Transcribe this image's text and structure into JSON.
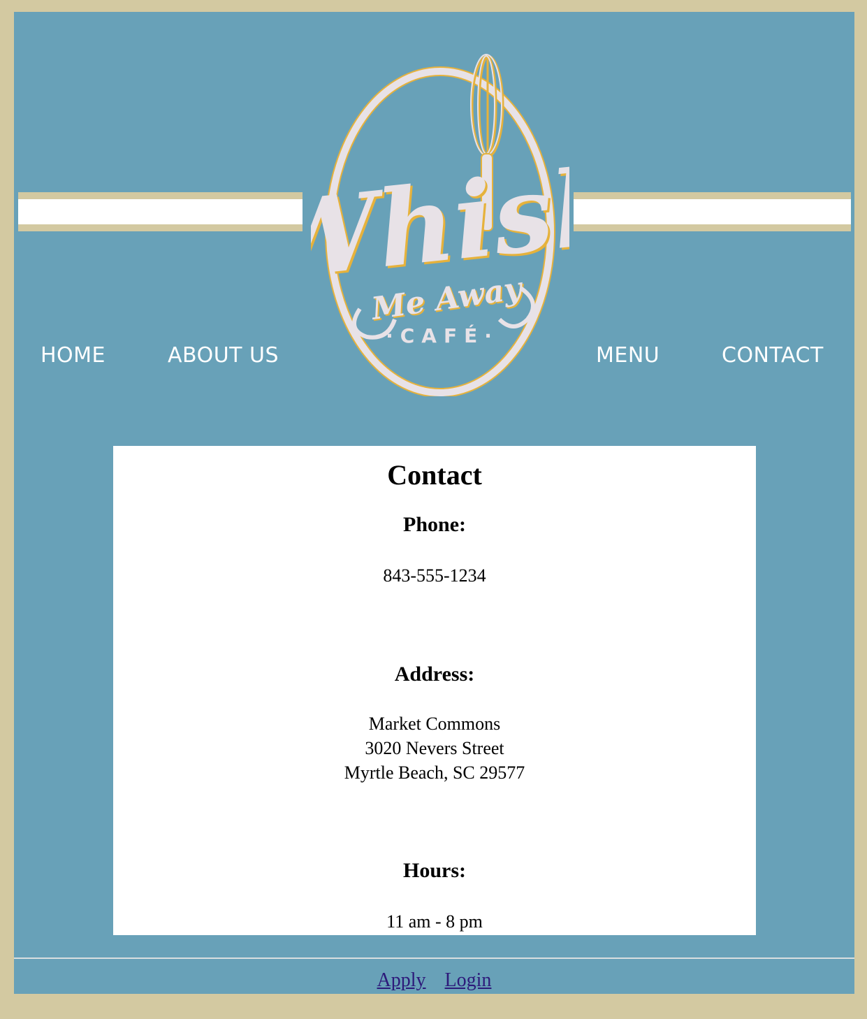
{
  "brand": {
    "logo_words": "Whisk Me Away",
    "logo_sub": "CAFÉ"
  },
  "nav": {
    "home": "HOME",
    "about": "ABOUT US",
    "menu": "MENU",
    "contact": "CONTACT"
  },
  "content": {
    "title": "Contact",
    "phone_heading": "Phone:",
    "phone": "843-555-1234",
    "address_heading": "Address:",
    "address_line1": "Market Commons",
    "address_line2": "3020 Nevers Street",
    "address_line3": "Myrtle Beach, SC 29577",
    "hours_heading": "Hours:",
    "hours": "11 am - 8 pm"
  },
  "footer": {
    "apply": "Apply",
    "login": "Login"
  },
  "colors": {
    "frame": "#d3c9a1",
    "background": "#68a1b8",
    "logo_cream": "#e8e2e7",
    "logo_gold": "#e6b23c",
    "link": "#2d1a7a"
  }
}
